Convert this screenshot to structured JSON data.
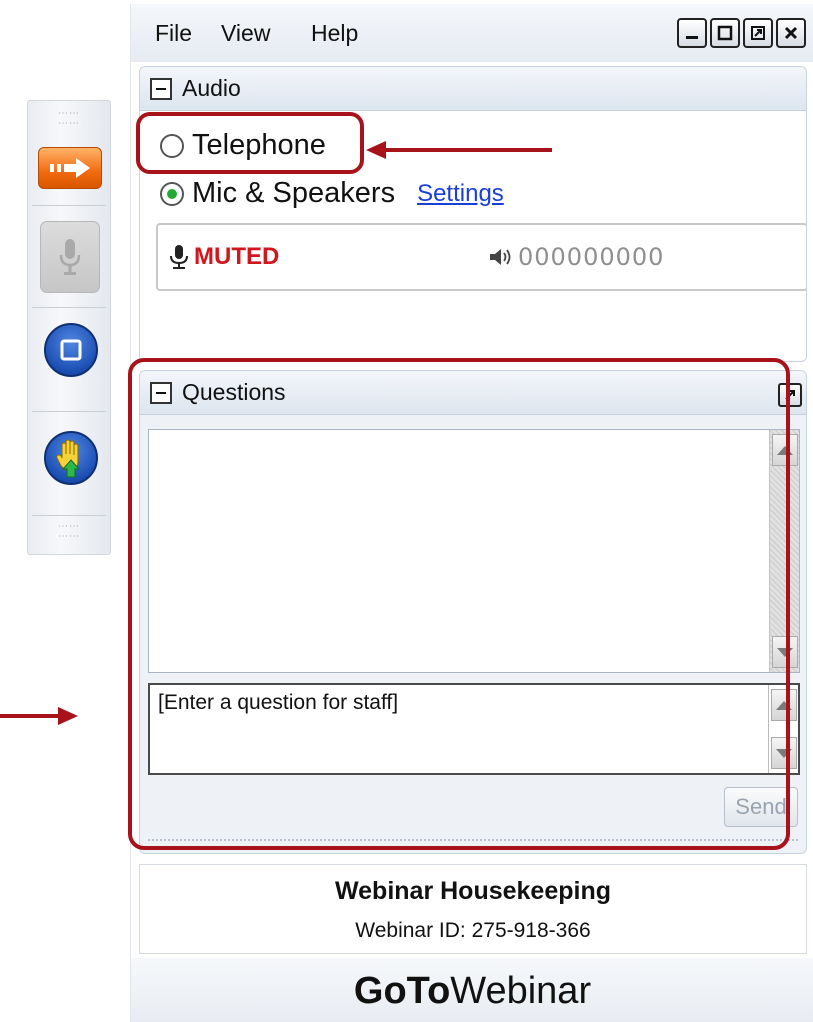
{
  "menu": {
    "file": "File",
    "view": "View",
    "help": "Help"
  },
  "window_controls": [
    "minimize-icon",
    "maximize-icon",
    "restore-icon",
    "close-icon"
  ],
  "audio": {
    "title": "Audio",
    "options": [
      {
        "label": "Telephone",
        "selected": false
      },
      {
        "label": "Mic & Speakers",
        "selected": true
      }
    ],
    "settings_link": "Settings",
    "mic_status": "MUTED",
    "volume_meter": "000000000"
  },
  "questions": {
    "title": "Questions",
    "input_placeholder": "[Enter a question for staff]",
    "send_label": "Send"
  },
  "info": {
    "title": "Webinar Housekeeping",
    "webinar_id": "Webinar ID: 275-918-366"
  },
  "brand": {
    "bold": "GoTo",
    "regular": "Webinar"
  },
  "colors": {
    "accent_orange": "#f26a0f",
    "muted_red": "#d1171e",
    "link_blue": "#1a3fd6",
    "annotation_red": "#a8121a",
    "radio_green": "#22aa33"
  },
  "toolbar_icons": [
    "arrow-icon",
    "microphone-icon",
    "screen-icon",
    "raise-hand-icon"
  ]
}
